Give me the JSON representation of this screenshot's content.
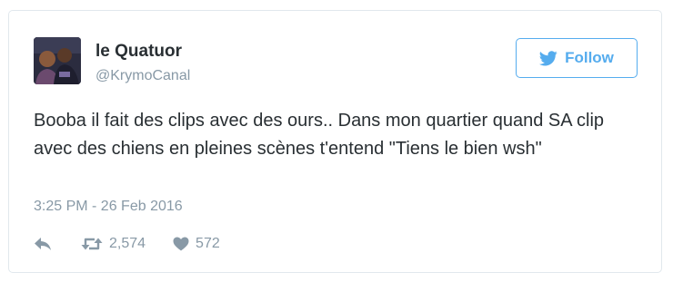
{
  "user": {
    "display_name": "le Quatuor",
    "handle": "@KrymoCanal"
  },
  "follow_button": {
    "label": "Follow",
    "icon": "twitter-bird-icon",
    "color": "#55acee"
  },
  "tweet": {
    "text": "Booba il fait des clips avec des ours.. Dans mon quartier quand SA clip avec des chiens en pleines scènes t'entend \"Tiens le bien wsh\"",
    "timestamp": "3:25 PM - 26 Feb 2016"
  },
  "actions": {
    "reply": {
      "icon": "reply-icon"
    },
    "retweet": {
      "icon": "retweet-icon",
      "count": "2,574"
    },
    "like": {
      "icon": "heart-icon",
      "count": "572"
    }
  },
  "colors": {
    "text": "#292f33",
    "muted": "#8899a6",
    "border": "#e1e8ed"
  }
}
